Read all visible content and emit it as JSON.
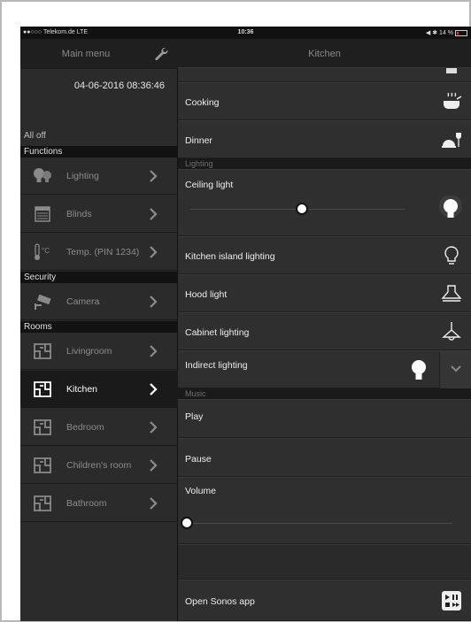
{
  "status_bar": {
    "carrier": "●●○○○ Telekom.de  LTE",
    "time": "10:36",
    "battery": "◀ ✱ 14 %"
  },
  "sidebar": {
    "title": "Main menu",
    "datetime": "04-06-2016 08:36:46",
    "all_off": "All off",
    "sections": {
      "functions": "Functions",
      "security": "Security",
      "rooms": "Rooms"
    },
    "functions": [
      {
        "label": "Lighting",
        "icon": "bulbs-icon"
      },
      {
        "label": "Blinds",
        "icon": "blinds-icon"
      },
      {
        "label": "Temp. (PIN 1234)",
        "icon": "thermometer-icon"
      }
    ],
    "security": [
      {
        "label": "Camera",
        "icon": "camera-icon"
      }
    ],
    "rooms": [
      {
        "label": "Livingroom",
        "icon": "room-icon"
      },
      {
        "label": "Kitchen",
        "icon": "room-icon",
        "active": true
      },
      {
        "label": "Bedroom",
        "icon": "room-icon"
      },
      {
        "label": "Children's room",
        "icon": "room-icon"
      },
      {
        "label": "Bathroom",
        "icon": "room-icon"
      }
    ]
  },
  "main": {
    "title": "Kitchen",
    "scenes": [
      {
        "label": "Cooking",
        "icon": "cooking-pot-icon"
      },
      {
        "label": "Dinner",
        "icon": "dinner-icon"
      }
    ],
    "lighting_section": "Lighting",
    "lighting": {
      "ceiling": {
        "label": "Ceiling light",
        "level": 0.52,
        "icon": "bulb-on-icon"
      },
      "items": [
        {
          "label": "Kitchen island lighting",
          "icon": "bulb-outline-icon"
        },
        {
          "label": "Hood light",
          "icon": "hood-light-icon"
        },
        {
          "label": "Cabinet lighting",
          "icon": "cabinet-lamp-icon"
        },
        {
          "label": "Indirect lighting",
          "icon": "bulb-on-icon"
        }
      ]
    },
    "music_section": "Music",
    "music": {
      "play": "Play",
      "pause": "Pause",
      "volume": "Volume",
      "volume_level": 0.0,
      "sonos": "Open Sonos app"
    }
  }
}
